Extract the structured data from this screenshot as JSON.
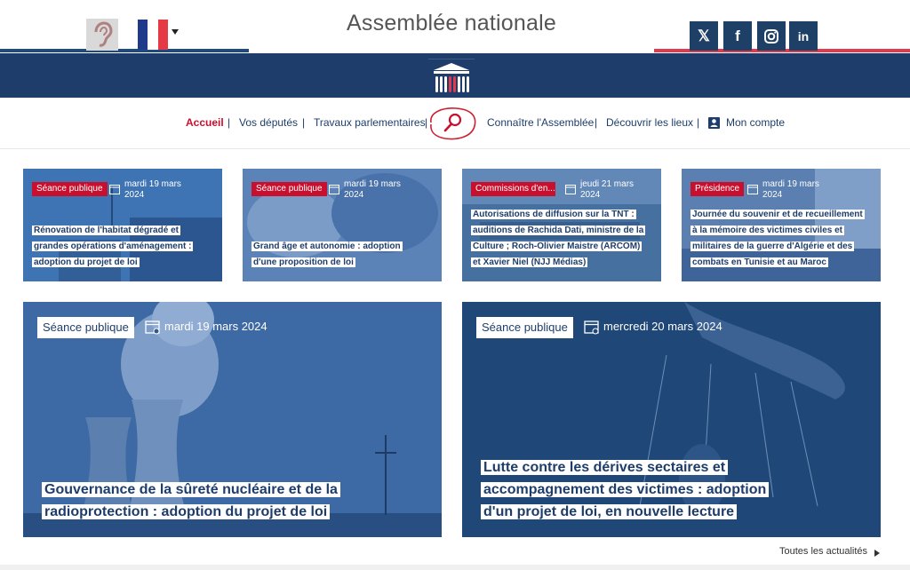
{
  "header": {
    "site_title": "Assemblée nationale",
    "accessibility_icon": "ear-icon",
    "language_flag": "france-flag",
    "social": [
      {
        "name": "x-icon",
        "glyph": "𝕏"
      },
      {
        "name": "facebook-icon",
        "glyph": "f"
      },
      {
        "name": "instagram-icon",
        "glyph": "◎"
      },
      {
        "name": "linkedin-icon",
        "glyph": "in"
      }
    ]
  },
  "nav": {
    "home": "Accueil",
    "deputies": "Vos députés",
    "parliamentary_work": "Travaux parlementaires",
    "know_assembly": "Connaître l'Assemblée",
    "discover_places": "Découvrir les lieux",
    "account": "Mon compte",
    "separator": "|"
  },
  "small_cards": [
    {
      "tag": "Séance publique",
      "date": "mardi 19 mars 2024",
      "title": "Rénovation de l'habitat dégradé et grandes opérations d'aménagement : adoption du projet de loi"
    },
    {
      "tag": "Séance publique",
      "date": "mardi 19 mars 2024",
      "title": "Grand âge et autonomie : adoption d'une proposition de loi"
    },
    {
      "tag": "Commissions d'en...",
      "date": "jeudi 21 mars 2024",
      "title": "Autorisations de diffusion sur la TNT : auditions de Rachida Dati, ministre de la Culture ; Roch-Olivier Maistre (ARCOM) et Xavier Niel (NJJ Médias)"
    },
    {
      "tag": "Présidence",
      "date": "mardi 19 mars 2024",
      "title": "Journée du souvenir et de recueillement à la mémoire des victimes civiles et militaires de la guerre d'Algérie et des combats en Tunisie et au Maroc"
    }
  ],
  "big_cards": [
    {
      "tag": "Séance publique",
      "date": "mardi 19 mars 2024",
      "title": "Gouvernance de la sûreté nucléaire et de la radioprotection : adoption du projet de loi"
    },
    {
      "tag": "Séance publique",
      "date": "mercredi 20 mars 2024",
      "title": "Lutte contre les dérives sectaires et accompagnement des victimes : adoption d'un projet de loi, en nouvelle lecture"
    }
  ],
  "footer": {
    "all_news": "Toutes les actualités"
  },
  "colors": {
    "navy": "#1e3d6b",
    "red": "#c8102e",
    "card_blue": "#2e5a93"
  }
}
